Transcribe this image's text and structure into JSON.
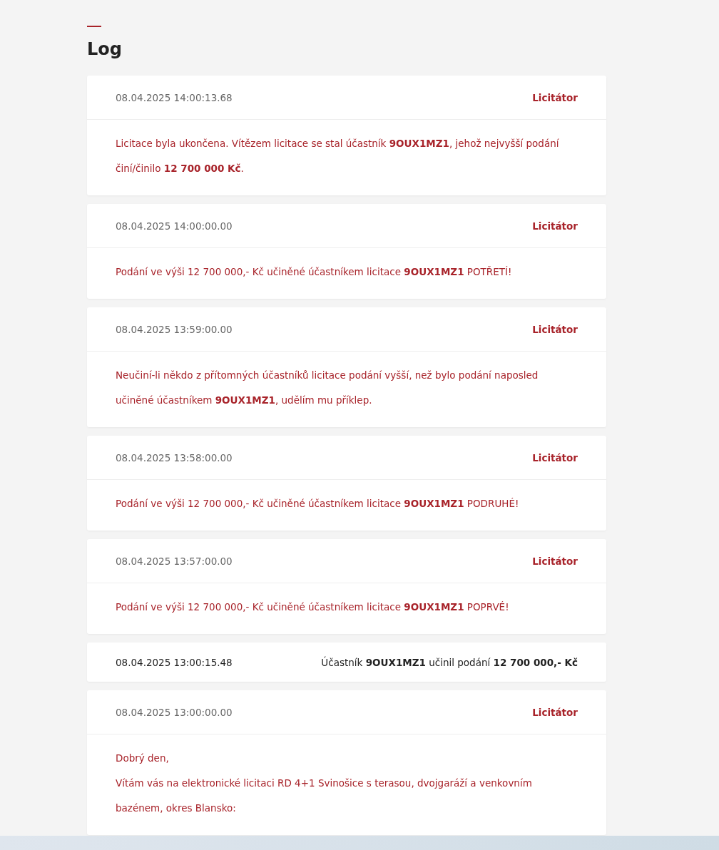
{
  "title": "Log",
  "entries": [
    {
      "kind": "auctioneer",
      "time": "08.04.2025 14:00:13.68",
      "author": "Licitátor",
      "paragraphs": [
        "Licitace byla ukončena. Vítězem licitace se stal účastník **9OUX1MZ1**, jehož nejvyšší podání činí/činilo **12 700 000 Kč**."
      ]
    },
    {
      "kind": "auctioneer",
      "time": "08.04.2025 14:00:00.00",
      "author": "Licitátor",
      "paragraphs": [
        "Podání ve výši 12 700 000,- Kč učiněné účastníkem licitace **9OUX1MZ1** POTŘETÍ!"
      ]
    },
    {
      "kind": "auctioneer",
      "time": "08.04.2025 13:59:00.00",
      "author": "Licitátor",
      "paragraphs": [
        "Neučiní-li někdo z přítomných účastníků licitace podání vyšší, než bylo podání naposled učiněné účastníkem **9OUX1MZ1**, udělím mu příklep."
      ]
    },
    {
      "kind": "auctioneer",
      "time": "08.04.2025 13:58:00.00",
      "author": "Licitátor",
      "paragraphs": [
        "Podání ve výši 12 700 000,- Kč učiněné účastníkem licitace **9OUX1MZ1** PODRUHÉ!"
      ]
    },
    {
      "kind": "auctioneer",
      "time": "08.04.2025 13:57:00.00",
      "author": "Licitátor",
      "paragraphs": [
        "Podání ve výši 12 700 000,- Kč učiněné účastníkem licitace **9OUX1MZ1** POPRVÉ!"
      ]
    },
    {
      "kind": "bid",
      "time": "08.04.2025 13:00:15.48",
      "message": "Účastník **9OUX1MZ1** učinil podání **12 700 000,- Kč**"
    },
    {
      "kind": "auctioneer",
      "time": "08.04.2025 13:00:00.00",
      "author": "Licitátor",
      "paragraphs": [
        "Dobrý den,",
        "Vítám vás na elektronické licitaci RD 4+1 Svinošice s terasou, dvojgaráží a venkovním bazénem, okres Blansko:"
      ]
    }
  ]
}
